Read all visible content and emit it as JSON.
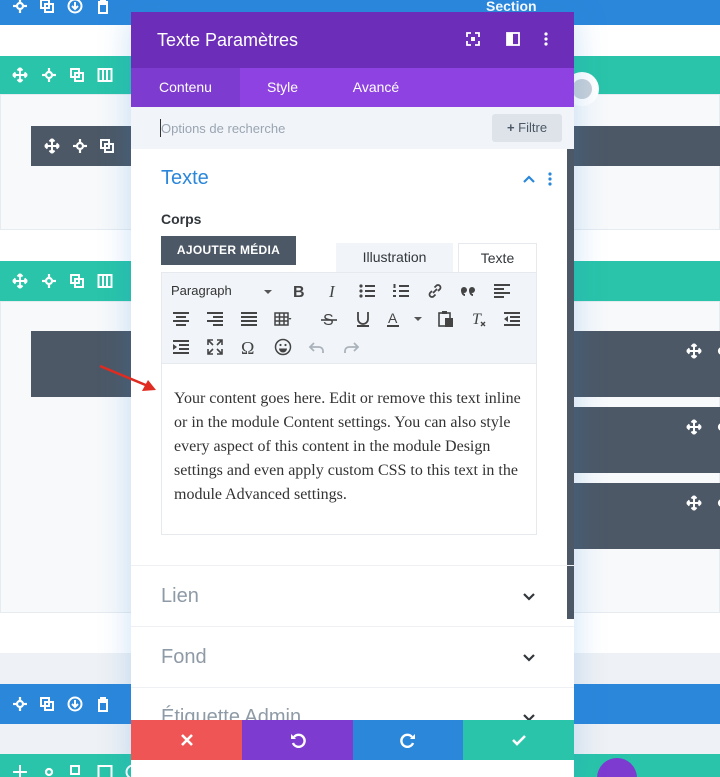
{
  "builder": {
    "section_label": "Section"
  },
  "modal": {
    "title": "Texte Paramètres",
    "tabs": [
      {
        "label": "Contenu"
      },
      {
        "label": "Style"
      },
      {
        "label": "Avancé"
      }
    ],
    "search": {
      "placeholder": "Options de recherche",
      "filter_label": "Filtre"
    },
    "groups": {
      "texte": {
        "title": "Texte",
        "body_label": "Corps",
        "add_media_label": "AJOUTER MÉDIA",
        "editor_tabs": [
          {
            "label": "Illustration"
          },
          {
            "label": "Texte"
          }
        ],
        "format_select": "Paragraph",
        "content": "Your content goes here. Edit or remove this text inline or in the module Content settings. You can also style every aspect of this content in the module Design settings and even apply custom CSS to this text in the module Advanced settings."
      },
      "lien": {
        "title": "Lien"
      },
      "fond": {
        "title": "Fond"
      },
      "etiquette": {
        "title": "Étiquette Admin"
      }
    }
  },
  "colors": {
    "header": "#6c2eb9",
    "tabs": "#8e42e1",
    "section_blue": "#2b87da",
    "row_teal": "#29c4a9",
    "module_slate": "#4c5866",
    "discard_red": "#ef5555",
    "undo_purple": "#7e3bd0",
    "redo_blue": "#2b87da",
    "save_green": "#29c4a9",
    "arrow_red": "#e02b20"
  }
}
